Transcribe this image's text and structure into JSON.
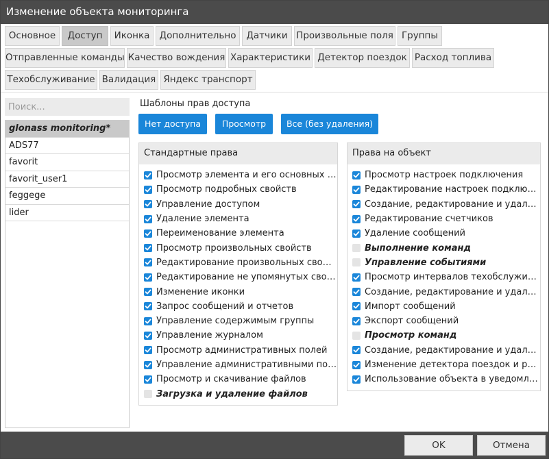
{
  "window": {
    "title": "Изменение объекта мониторинга"
  },
  "tabs": [
    {
      "label": "Основное"
    },
    {
      "label": "Доступ"
    },
    {
      "label": "Иконка"
    },
    {
      "label": "Дополнительно"
    },
    {
      "label": "Датчики"
    },
    {
      "label": "Произвольные поля"
    },
    {
      "label": "Группы"
    },
    {
      "label": "Отправленные команды"
    },
    {
      "label": "Качество вождения"
    },
    {
      "label": "Характеристики"
    },
    {
      "label": "Детектор поездок"
    },
    {
      "label": "Расход топлива"
    },
    {
      "label": "Техобслуживание"
    },
    {
      "label": "Валидация"
    },
    {
      "label": "Яндекс транспорт"
    }
  ],
  "active_tab": "Доступ",
  "search": {
    "placeholder": "Поиск...",
    "value": ""
  },
  "users": [
    {
      "name": "glonass monitoring*",
      "selected": true
    },
    {
      "name": "ADS77"
    },
    {
      "name": "favorit"
    },
    {
      "name": "favorit_user1"
    },
    {
      "name": "feggege"
    },
    {
      "name": "lider"
    }
  ],
  "templates": {
    "label": "Шаблоны прав доступа",
    "buttons": [
      "Нет доступа",
      "Просмотр",
      "Все (без удаления)"
    ]
  },
  "standard_rights": {
    "header": "Стандартные права",
    "items": [
      {
        "label": "Просмотр элемента и его основных св...",
        "checked": true
      },
      {
        "label": "Просмотр подробных свойств",
        "checked": true
      },
      {
        "label": "Управление доступом",
        "checked": true
      },
      {
        "label": "Удаление элемента",
        "checked": true
      },
      {
        "label": "Переименование элемента",
        "checked": true
      },
      {
        "label": "Просмотр произвольных свойств",
        "checked": true
      },
      {
        "label": "Редактирование произвольных свойств",
        "checked": true
      },
      {
        "label": "Редактирование не упомянутых свойств",
        "checked": true
      },
      {
        "label": "Изменение иконки",
        "checked": true
      },
      {
        "label": "Запрос сообщений и отчетов",
        "checked": true
      },
      {
        "label": "Управление содержимым группы",
        "checked": true
      },
      {
        "label": "Управление журналом",
        "checked": true
      },
      {
        "label": "Просмотр административных полей",
        "checked": true
      },
      {
        "label": "Управление административными поля...",
        "checked": true
      },
      {
        "label": "Просмотр и скачивание файлов",
        "checked": true
      },
      {
        "label": "Загрузка и удаление файлов",
        "checked": false,
        "bold": true
      }
    ]
  },
  "object_rights": {
    "header": "Права на объект",
    "items": [
      {
        "label": "Просмотр настроек подключения",
        "checked": true
      },
      {
        "label": "Редактирование настроек подключения",
        "checked": true
      },
      {
        "label": "Создание, редактирование и удаление...",
        "checked": true
      },
      {
        "label": "Редактирование счетчиков",
        "checked": true
      },
      {
        "label": "Удаление сообщений",
        "checked": true
      },
      {
        "label": "Выполнение команд",
        "checked": false,
        "bold": true
      },
      {
        "label": "Управление событиями",
        "checked": false,
        "bold": true
      },
      {
        "label": "Просмотр интервалов техобслуживания",
        "checked": true
      },
      {
        "label": "Создание, редактирование и удаление...",
        "checked": true
      },
      {
        "label": "Импорт сообщений",
        "checked": true
      },
      {
        "label": "Экспорт сообщений",
        "checked": true
      },
      {
        "label": "Просмотр команд",
        "checked": false,
        "bold": true
      },
      {
        "label": "Создание, редактирование и удаление...",
        "checked": true
      },
      {
        "label": "Изменение детектора поездок и расхо...",
        "checked": true
      },
      {
        "label": "Использование объекта в уведомлени...",
        "checked": true
      }
    ]
  },
  "footer": {
    "ok_label": "OK",
    "cancel_label": "Отмена"
  },
  "colors": {
    "accent": "#1a86d9",
    "titlebar": "#4b4b4b"
  }
}
